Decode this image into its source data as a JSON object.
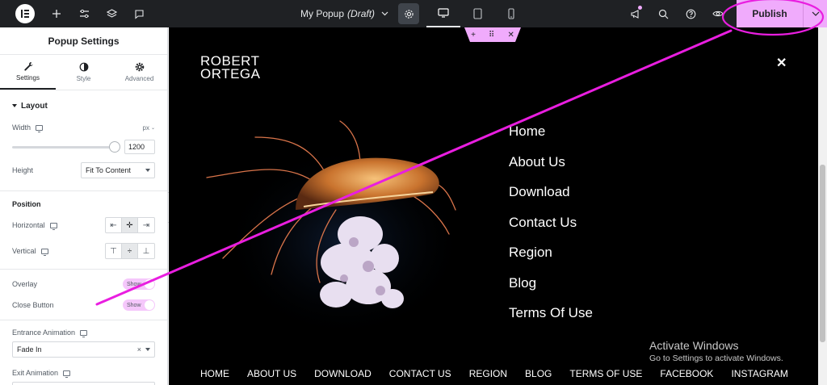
{
  "topbar": {
    "doc_title": "My Popup",
    "doc_status": "(Draft)",
    "publish_label": "Publish"
  },
  "panel": {
    "title": "Popup Settings",
    "tabs": [
      {
        "label": "Settings",
        "icon": "wrench-icon"
      },
      {
        "label": "Style",
        "icon": "contrast-icon"
      },
      {
        "label": "Advanced",
        "icon": "gear-icon"
      }
    ],
    "layout_title": "Layout",
    "width_label": "Width",
    "width_unit": "px",
    "width_value": "1200",
    "width_slider_fraction": 0.98,
    "height_label": "Height",
    "height_value": "Fit To Content",
    "position_title": "Position",
    "horizontal_label": "Horizontal",
    "vertical_label": "Vertical",
    "overlay_label": "Overlay",
    "overlay_value": "Show",
    "close_button_label": "Close Button",
    "close_button_value": "Show",
    "entrance_label": "Entrance Animation",
    "entrance_value": "Fade In",
    "exit_label": "Exit Animation"
  },
  "popup": {
    "brand_line1": "ROBERT",
    "brand_line2": "ORTEGA",
    "close_glyph": "✕",
    "menu": [
      "Home",
      "About Us",
      "Download",
      "Contact Us",
      "Region",
      "Blog",
      "Terms Of Use"
    ],
    "footer": [
      "HOME",
      "ABOUT US",
      "DOWNLOAD",
      "CONTACT US",
      "REGION",
      "BLOG",
      "TERMS OF USE",
      "FACEBOOK",
      "INSTAGRAM"
    ]
  },
  "watermark": {
    "line1": "Activate Windows",
    "line2": "Go to Settings to activate Windows."
  },
  "colors": {
    "accent": "#f0abfc",
    "annotation": "#e91ee0",
    "topbar": "#1f2124"
  }
}
